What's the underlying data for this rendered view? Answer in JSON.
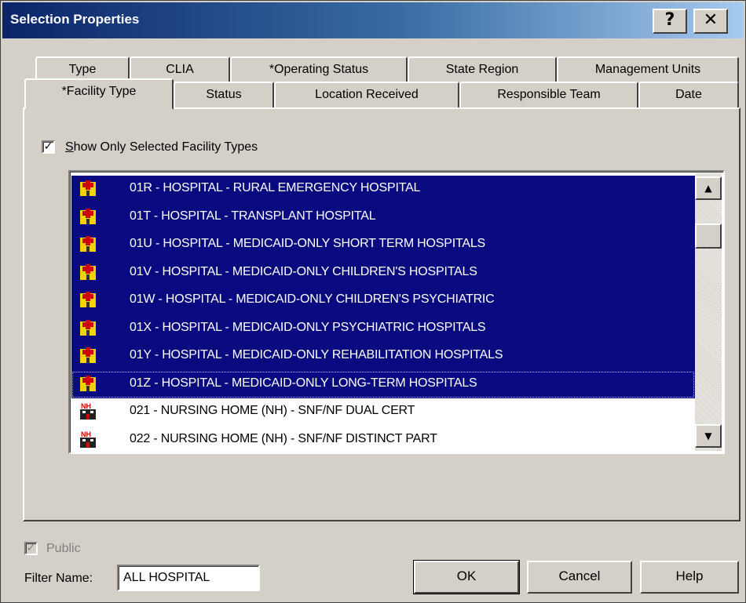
{
  "window": {
    "title": "Selection Properties",
    "help_glyph": "?",
    "close_glyph": "✕"
  },
  "tabs": {
    "back_row": [
      "Type",
      "CLIA",
      "*Operating Status",
      "State Region",
      "Management Units"
    ],
    "front_row": [
      "*Facility Type",
      "Status",
      "Location Received",
      "Responsible Team",
      "Date"
    ],
    "active": "*Facility Type"
  },
  "panel": {
    "show_only_label_prefix": "S",
    "show_only_label_rest": "how Only Selected Facility Types",
    "show_only_checked": true,
    "list_items": [
      {
        "label": "01R - HOSPITAL - RURAL EMERGENCY HOSPITAL",
        "selected": true,
        "icon": "hospital-icon"
      },
      {
        "label": "01T - HOSPITAL - TRANSPLANT HOSPITAL",
        "selected": true,
        "icon": "hospital-icon"
      },
      {
        "label": "01U - HOSPITAL - MEDICAID-ONLY SHORT TERM HOSPITALS",
        "selected": true,
        "icon": "hospital-icon"
      },
      {
        "label": "01V - HOSPITAL - MEDICAID-ONLY CHILDREN'S HOSPITALS",
        "selected": true,
        "icon": "hospital-icon"
      },
      {
        "label": "01W - HOSPITAL - MEDICAID-ONLY CHILDREN'S PSYCHIATRIC",
        "selected": true,
        "icon": "hospital-icon"
      },
      {
        "label": "01X - HOSPITAL - MEDICAID-ONLY PSYCHIATRIC HOSPITALS",
        "selected": true,
        "icon": "hospital-icon"
      },
      {
        "label": "01Y - HOSPITAL - MEDICAID-ONLY REHABILITATION HOSPITALS",
        "selected": true,
        "icon": "hospital-icon"
      },
      {
        "label": "01Z - HOSPITAL - MEDICAID-ONLY LONG-TERM HOSPITALS",
        "selected": true,
        "icon": "hospital-icon"
      },
      {
        "label": "021 - NURSING HOME (NH) - SNF/NF DUAL CERT",
        "selected": false,
        "icon": "nursing-home-icon"
      },
      {
        "label": "022 - NURSING HOME (NH) - SNF/NF DISTINCT PART",
        "selected": false,
        "icon": "nursing-home-icon"
      }
    ]
  },
  "bottom": {
    "public_label": "Public",
    "public_checked": true,
    "filter_label": "Filter Name:",
    "filter_value": "ALL HOSPITAL",
    "ok_label": "OK",
    "cancel_label": "Cancel",
    "help_label": "Help"
  },
  "colors": {
    "selection": "#0a0a80",
    "dialog_face": "#d4d0c8",
    "titlebar_start": "#0a246a"
  }
}
